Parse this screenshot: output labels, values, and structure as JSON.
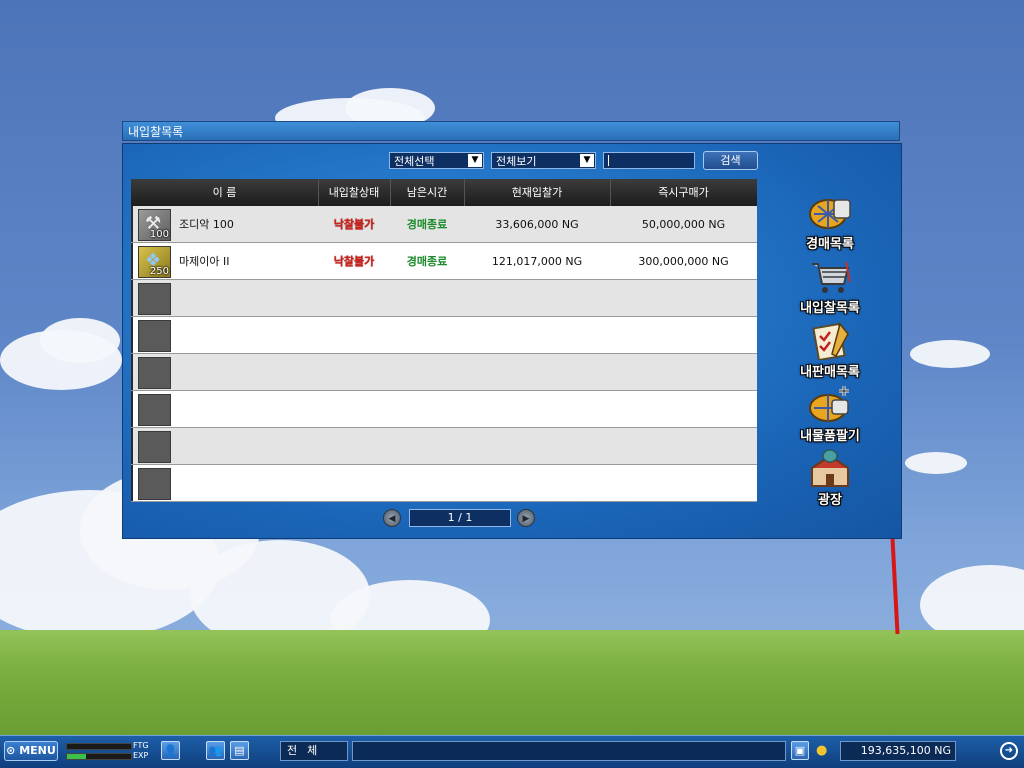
{
  "window": {
    "title": "내입찰목록"
  },
  "filters": {
    "category": {
      "selected": "전체선택"
    },
    "view": {
      "selected": "전체보기"
    },
    "search_value": "",
    "search_label": "검색"
  },
  "table": {
    "headers": {
      "name": "이 름",
      "status": "내입찰상태",
      "time": "남은시간",
      "current_bid": "현재입찰가",
      "buyout": "즉시구매가"
    },
    "rows": [
      {
        "name": "조디악 100",
        "qty": "100",
        "status": "낙찰불가",
        "time": "경매종료",
        "current_bid": "33,606,000 NG",
        "buyout": "50,000,000 NG"
      },
      {
        "name": "마제이아 II",
        "qty": "250",
        "status": "낙찰불가",
        "time": "경매종료",
        "current_bid": "121,017,000 NG",
        "buyout": "300,000,000 NG"
      }
    ]
  },
  "pager": {
    "display": "1 / 1"
  },
  "side_menu": {
    "auction_list": "경매목록",
    "my_bids": "내입찰목록",
    "my_sales": "내판매목록",
    "sell_item": "내물품팔기",
    "plaza": "광장"
  },
  "taskbar": {
    "menu_label": "MENU",
    "ftg_label": "FTG",
    "exp_label": "EXP",
    "chat_channel": "전체",
    "money": "193,635,100 NG"
  }
}
